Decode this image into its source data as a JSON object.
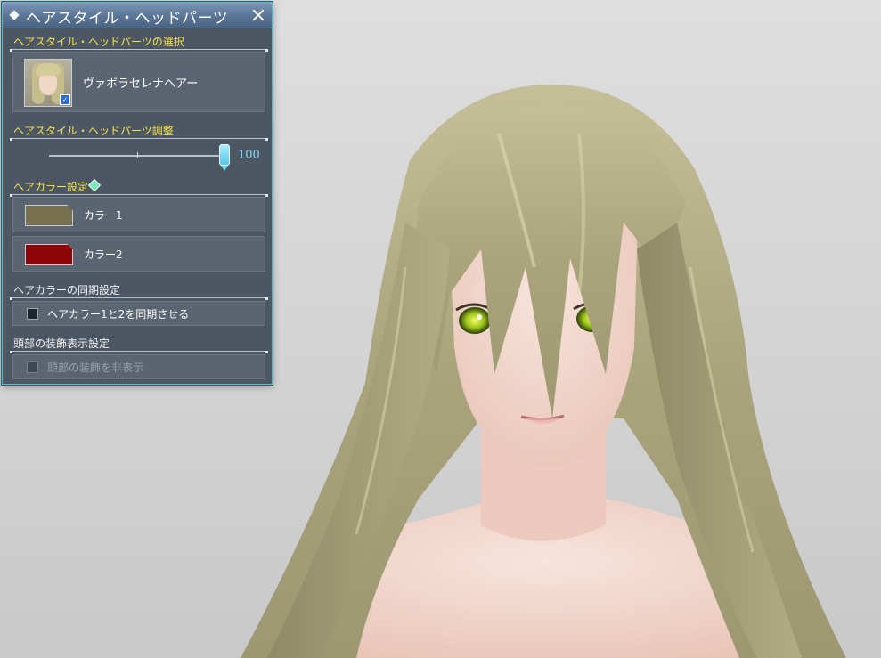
{
  "window": {
    "title": "ヘアスタイル・ヘッドパーツ"
  },
  "sections": {
    "selection": {
      "heading": "ヘアスタイル・ヘッドパーツの選択",
      "item_name": "ヴァボラセレナヘアー"
    },
    "adjust": {
      "heading": "ヘアスタイル・ヘッドパーツ調整",
      "value": "100",
      "fraction": 1.0
    },
    "hair_color": {
      "heading": "ヘアカラー設定",
      "color1_label": "カラー1",
      "color1_hex": "#77704e",
      "color2_label": "カラー2",
      "color2_hex": "#8d0505"
    },
    "sync": {
      "heading": "ヘアカラーの同期設定",
      "checkbox_label": "ヘアカラー1と2を同期させる",
      "checked": false
    },
    "head_deco": {
      "heading": "頭部の装飾表示設定",
      "checkbox_label": "頭部の装飾を非表示",
      "checked": false,
      "enabled": false
    }
  },
  "colors": {
    "accent": "#5fb9cf",
    "heading_yellow": "#f3e24a",
    "hair_blonde": "#b7b28a"
  },
  "icons": {
    "close": "close-icon",
    "title": "diamond-icon",
    "premium": "gem-icon"
  }
}
